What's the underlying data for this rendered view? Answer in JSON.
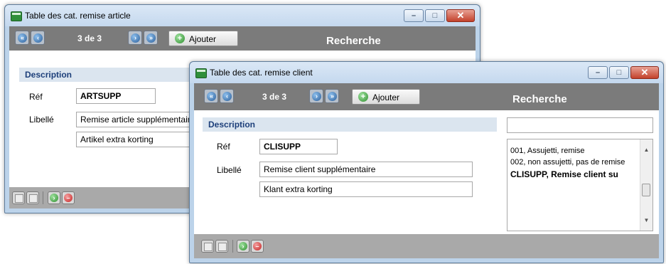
{
  "window_article": {
    "title": "Table des cat. remise article",
    "toolbar": {
      "counter": "3 de 3",
      "add_label": "Ajouter",
      "search_title": "Recherche"
    },
    "section_title": "Description",
    "ref_label": "Réf",
    "ref_value": "ARTSUPP",
    "libelle_label": "Libellé",
    "libelle_fr": "Remise article supplémentaire",
    "libelle_nl": "Artikel extra korting"
  },
  "window_client": {
    "title": "Table des cat. remise client",
    "toolbar": {
      "counter": "3 de 3",
      "add_label": "Ajouter",
      "search_title": "Recherche"
    },
    "section_title": "Description",
    "ref_label": "Réf",
    "ref_value": "CLISUPP",
    "libelle_label": "Libellé",
    "libelle_fr": "Remise client supplémentaire",
    "libelle_nl": "Klant extra korting",
    "search_value": "",
    "search_list": [
      "001, Assujetti, remise",
      "002, non assujetti, pas de remise",
      "CLISUPP, Remise client su"
    ]
  },
  "icons": {
    "nav": [
      "first-icon",
      "previous-icon",
      "next-icon",
      "last-icon"
    ],
    "footer": [
      "save-icon",
      "undo-icon",
      "validate-icon",
      "delete-icon"
    ]
  }
}
